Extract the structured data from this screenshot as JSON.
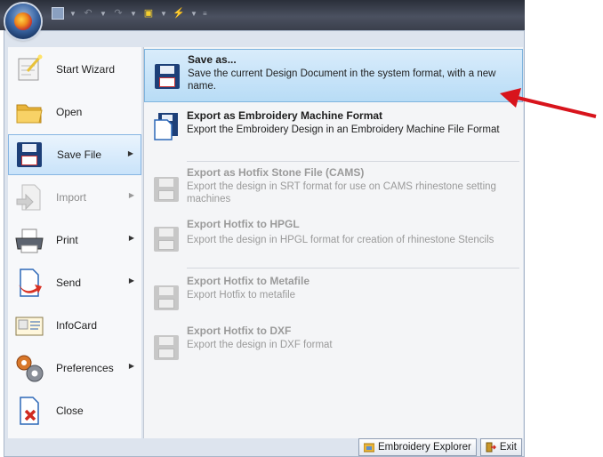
{
  "left_menu": {
    "items": [
      {
        "label": "Start Wizard",
        "icon": "wizard-icon",
        "disabled": false,
        "submenu": false
      },
      {
        "label": "Open",
        "icon": "folder-icon",
        "disabled": false,
        "submenu": false
      },
      {
        "label": "Save File",
        "icon": "floppy-disk-icon",
        "disabled": false,
        "submenu": true,
        "active": true
      },
      {
        "label": "Import",
        "icon": "import-icon",
        "disabled": true,
        "submenu": true
      },
      {
        "label": "Print",
        "icon": "printer-icon",
        "disabled": false,
        "submenu": true
      },
      {
        "label": "Send",
        "icon": "send-icon",
        "disabled": false,
        "submenu": true
      },
      {
        "label": "InfoCard",
        "icon": "infocard-icon",
        "disabled": false,
        "submenu": false
      },
      {
        "label": "Preferences",
        "icon": "gears-icon",
        "disabled": false,
        "submenu": true
      },
      {
        "label": "Close",
        "icon": "close-document-icon",
        "disabled": false,
        "submenu": false
      }
    ]
  },
  "submenu": {
    "items": [
      {
        "title": "Save as...",
        "desc": "Save the current Design Document in the system format, with a new name.",
        "disabled": false,
        "highlighted": true
      },
      {
        "title": "Export as Embroidery Machine Format",
        "desc": "Export the Embroidery Design in an Embroidery Machine File Format",
        "disabled": false
      },
      {
        "title": "Export as Hotfix Stone File (CAMS)",
        "desc": "Export the design in SRT format for use on CAMS rhinestone setting machines",
        "disabled": true
      },
      {
        "title": "Export Hotfix to HPGL",
        "desc": "Export the design in HPGL format for creation of rhinestone Stencils",
        "disabled": true
      },
      {
        "title": "Export Hotfix to Metafile",
        "desc": "Export Hotfix to metafile",
        "disabled": true
      },
      {
        "title": "Export Hotfix to DXF",
        "desc": "Export the design in DXF format",
        "disabled": true
      }
    ]
  },
  "bottom": {
    "explorer_label": "Embroidery Explorer",
    "exit_label": "Exit"
  },
  "colors": {
    "accent": "#c9e3fa",
    "annotation_arrow": "#d8141c",
    "floppy": "#1d3f78"
  }
}
